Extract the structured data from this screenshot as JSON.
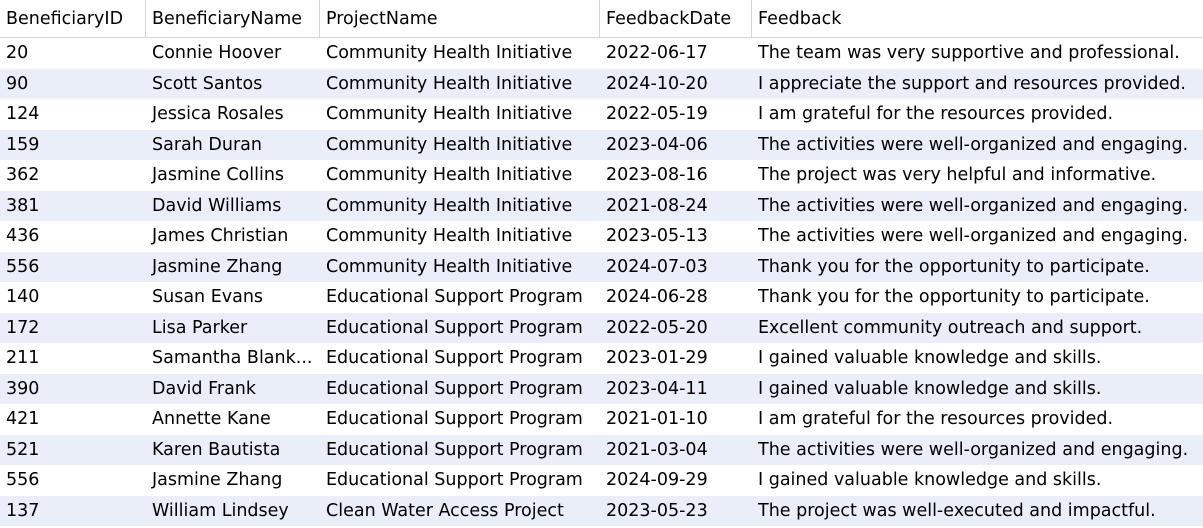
{
  "table": {
    "columns": [
      "BeneficiaryID",
      "BeneficiaryName",
      "ProjectName",
      "FeedbackDate",
      "Feedback"
    ],
    "rows": [
      [
        "20",
        "Connie Hoover",
        "Community Health Initiative",
        "2022-06-17",
        "The team was very supportive and professional."
      ],
      [
        "90",
        "Scott Santos",
        "Community Health Initiative",
        "2024-10-20",
        "I appreciate the support and resources provided."
      ],
      [
        "124",
        "Jessica Rosales",
        "Community Health Initiative",
        "2022-05-19",
        "I am grateful for the resources provided."
      ],
      [
        "159",
        "Sarah Duran",
        "Community Health Initiative",
        "2023-04-06",
        "The activities were well-organized and engaging."
      ],
      [
        "362",
        "Jasmine Collins",
        "Community Health Initiative",
        "2023-08-16",
        "The project was very helpful and informative."
      ],
      [
        "381",
        "David Williams",
        "Community Health Initiative",
        "2021-08-24",
        "The activities were well-organized and engaging."
      ],
      [
        "436",
        "James Christian",
        "Community Health Initiative",
        "2023-05-13",
        "The activities were well-organized and engaging."
      ],
      [
        "556",
        "Jasmine Zhang",
        "Community Health Initiative",
        "2024-07-03",
        "Thank you for the opportunity to participate."
      ],
      [
        "140",
        "Susan Evans",
        "Educational Support Program",
        "2024-06-28",
        "Thank you for the opportunity to participate."
      ],
      [
        "172",
        "Lisa Parker",
        "Educational Support Program",
        "2022-05-20",
        "Excellent community outreach and support."
      ],
      [
        "211",
        "Samantha Blank...",
        "Educational Support Program",
        "2023-01-29",
        "I gained valuable knowledge and skills."
      ],
      [
        "390",
        "David Frank",
        "Educational Support Program",
        "2023-04-11",
        "I gained valuable knowledge and skills."
      ],
      [
        "421",
        "Annette Kane",
        "Educational Support Program",
        "2021-01-10",
        "I am grateful for the resources provided."
      ],
      [
        "521",
        "Karen Bautista",
        "Educational Support Program",
        "2021-03-04",
        "The activities were well-organized and engaging."
      ],
      [
        "556",
        "Jasmine Zhang",
        "Educational Support Program",
        "2024-09-29",
        "I gained valuable knowledge and skills."
      ],
      [
        "137",
        "William Lindsey",
        "Clean Water Access Project",
        "2023-05-23",
        "The project was well-executed and impactful."
      ]
    ]
  },
  "colors": {
    "alt_row": "#e9eef9",
    "grid_line": "#d4d4d4"
  }
}
